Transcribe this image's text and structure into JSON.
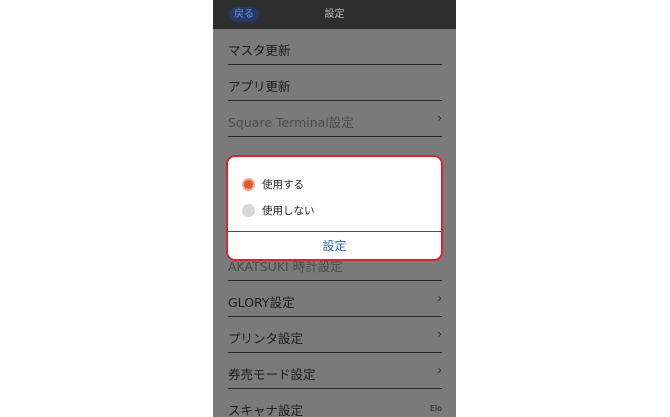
{
  "header": {
    "back_label": "戻る",
    "title": "設定"
  },
  "list_items": [
    {
      "label": "マスタ更新",
      "chevron": ""
    },
    {
      "label": "アプリ更新",
      "chevron": ""
    },
    {
      "label": "Square Terminal設定",
      "chevron": "›"
    },
    {
      "label": "AKATSUKI 時計設定",
      "chevron": ""
    },
    {
      "label": "GLORY設定",
      "chevron": "›"
    },
    {
      "label": "プリンタ設定",
      "chevron": "›"
    },
    {
      "label": "券売モード設定",
      "chevron": "›"
    },
    {
      "label": "スキャナ設定",
      "chevron": "",
      "badge": "Elo"
    }
  ],
  "dialog": {
    "options": [
      {
        "label": "使用する",
        "selected": true
      },
      {
        "label": "使用しない",
        "selected": false
      }
    ],
    "confirm_label": "設定"
  },
  "colors": {
    "highlight_border": "#d9232d",
    "radio_selected": "#e35a2e",
    "confirm_text": "#2f5cc8"
  }
}
